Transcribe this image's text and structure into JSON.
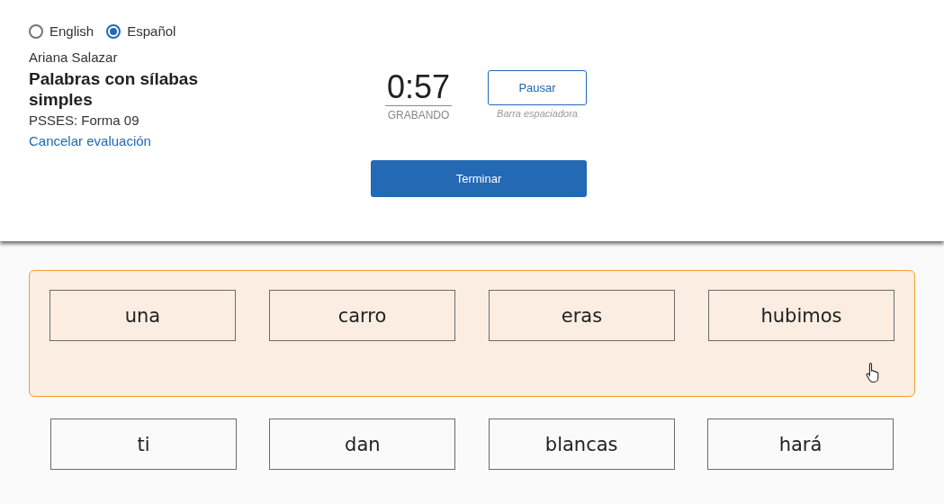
{
  "language_options": [
    {
      "label": "English",
      "selected": false
    },
    {
      "label": "Español",
      "selected": true
    }
  ],
  "student_name": "Ariana Salazar",
  "assessment_title": "Palabras con sílabas simples",
  "form_label": "PSSES: Forma 09",
  "cancel_link": "Cancelar evaluación",
  "timer": {
    "time": "0:57",
    "status": "GRABANDO"
  },
  "pause_button": {
    "label": "Pausar",
    "hint": "Barra espaciadora"
  },
  "finish_button": "Terminar",
  "word_rows": [
    {
      "highlighted": true,
      "words": [
        "una",
        "carro",
        "eras",
        "hubimos"
      ]
    },
    {
      "highlighted": false,
      "words": [
        "ti",
        "dan",
        "blancas",
        "hará"
      ]
    }
  ]
}
